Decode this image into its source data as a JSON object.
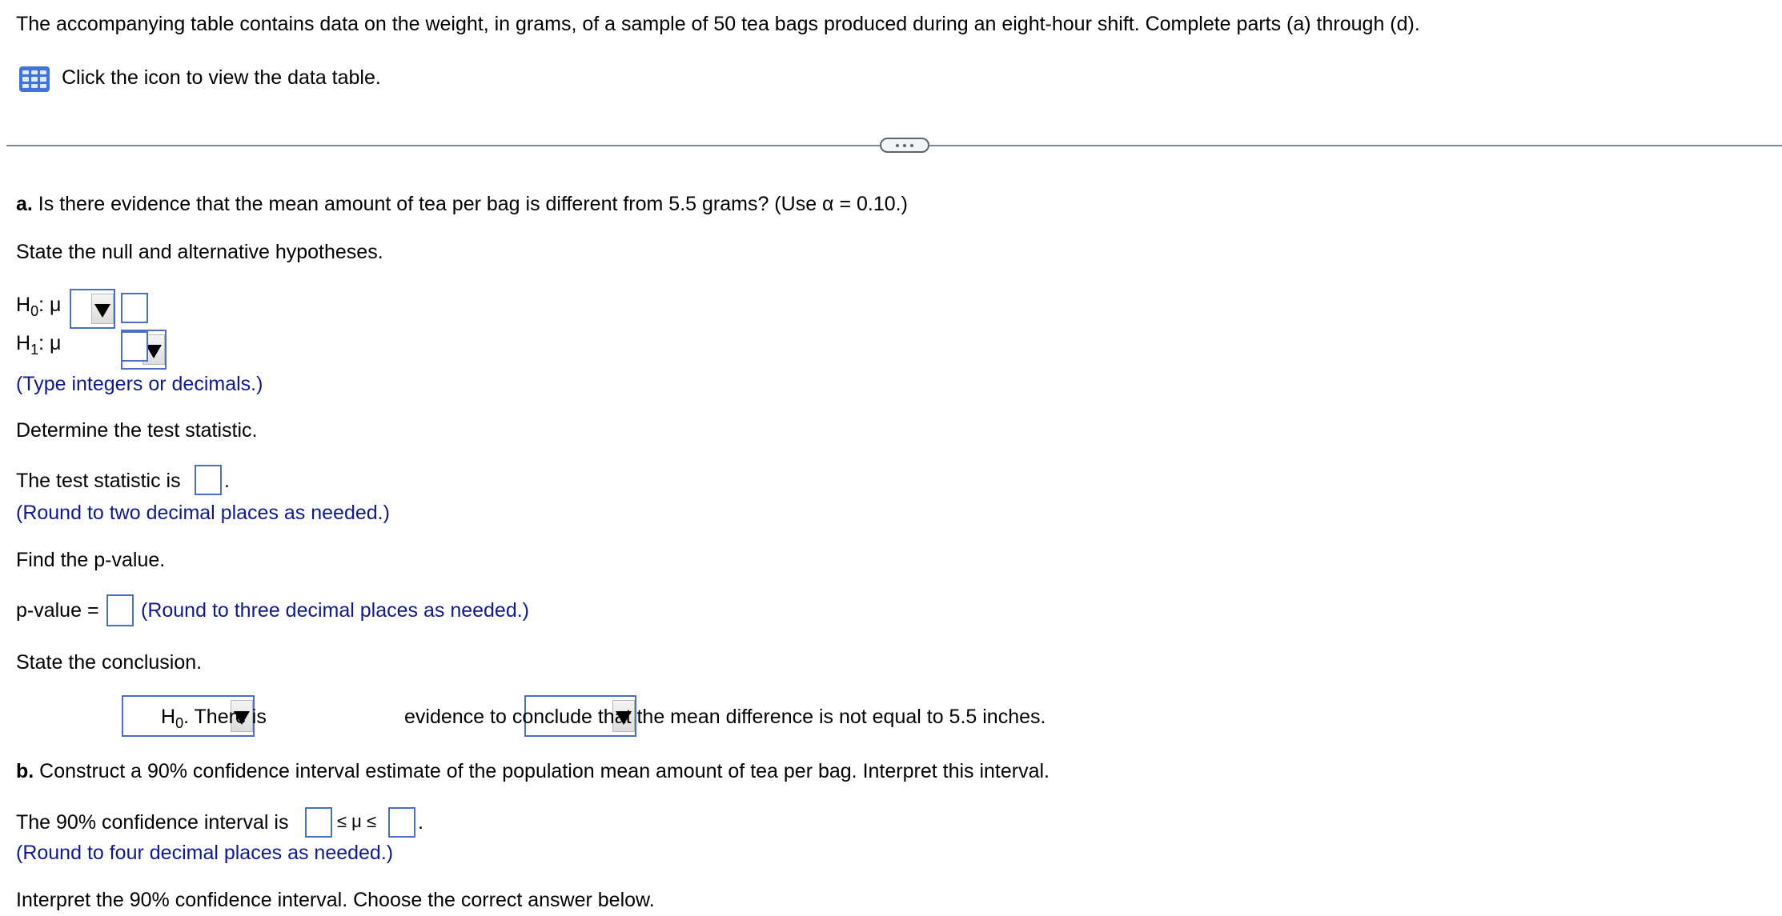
{
  "intro": {
    "text": "The accompanying table contains data on the weight, in grams, of a sample of 50 tea bags produced during an eight-hour shift. Complete parts (a) through (d).",
    "data_table_link": "Click the icon to view the data table.",
    "data_table_icon": "table-grid-icon"
  },
  "divider": {
    "more_button_icon": "ellipsis-icon"
  },
  "part_a": {
    "label": "a.",
    "question": " Is there evidence that the mean amount of tea per bag is different from 5.5 grams? (Use α = 0.10.)",
    "hypotheses_prompt": "State the null and alternative hypotheses.",
    "h0_label": "H",
    "h0_sub": "0",
    "h1_label": "H",
    "h1_sub": "1",
    "mu_label": ": μ",
    "h0_operator": "",
    "h0_value": "",
    "h1_operator": "",
    "h1_value": "",
    "hypotheses_hint": "(Type integers or decimals.)",
    "test_stat_prompt": "Determine the test statistic.",
    "test_stat_label": "The test statistic is",
    "test_stat_value": "",
    "test_stat_hint": "(Round to two decimal places as needed.)",
    "pvalue_prompt": "Find the p-value.",
    "pvalue_label": "p-value =",
    "pvalue_value": "",
    "pvalue_hint": "(Round to three decimal places as needed.)",
    "conclusion_prompt": "State the conclusion.",
    "conclusion_decision": "",
    "conclusion_h0": "H",
    "conclusion_h0_sub": "0",
    "conclusion_mid": ". There is",
    "conclusion_evidence": "",
    "conclusion_tail": "evidence to conclude that the mean difference is not equal to 5.5 inches."
  },
  "part_b": {
    "label": "b.",
    "question": " Construct a 90% confidence interval estimate of the population mean amount of tea per bag. Interpret this interval.",
    "ci_label": "The 90% confidence interval is",
    "ci_lower": "",
    "ci_middle": "≤ μ ≤",
    "ci_upper": "",
    "ci_hint": "(Round to four decimal places as needed.)",
    "interpret_prompt": "Interpret the 90% confidence interval. Choose the correct answer below."
  }
}
